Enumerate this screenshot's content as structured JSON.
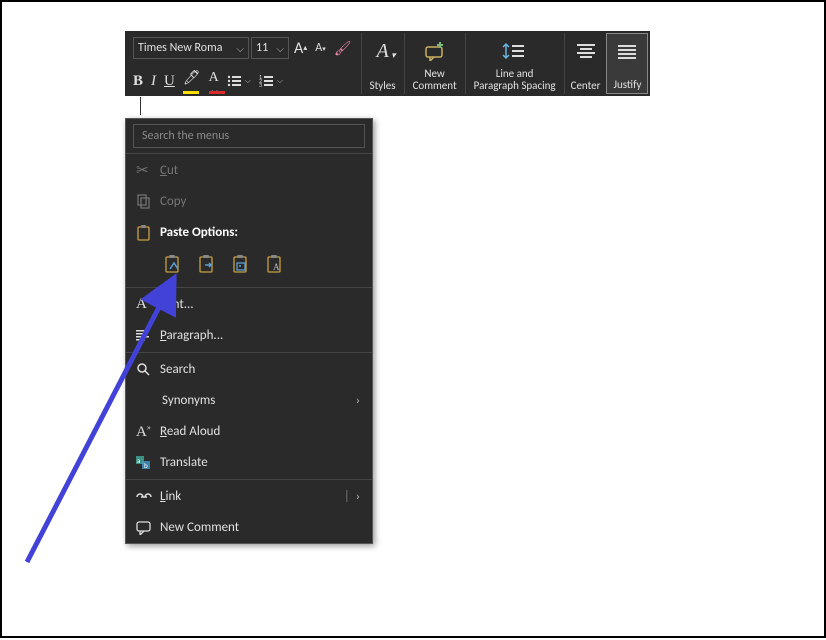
{
  "toolbar": {
    "font_name": "Times New Roma",
    "font_size": "11",
    "styles_label": "Styles",
    "new_comment_label1": "New",
    "new_comment_label2": "Comment",
    "spacing_label1": "Line and",
    "spacing_label2": "Paragraph Spacing",
    "center_label": "Center",
    "justify_label": "Justify",
    "bold": "B",
    "italic": "I",
    "underline": "U"
  },
  "context_menu": {
    "search_placeholder": "Search the menus",
    "cut": "Cut",
    "copy": "Copy",
    "paste_options": "Paste Options:",
    "font": "Font...",
    "paragraph": "Paragraph...",
    "search": "Search",
    "synonyms": "Synonyms",
    "read_aloud": "Read Aloud",
    "translate": "Translate",
    "link": "Link",
    "new_comment": "New Comment"
  },
  "icons": {
    "cut": "scissors-icon",
    "copy": "copy-icon",
    "paste": "clipboard-icon",
    "font": "font-a-icon",
    "paragraph": "paragraph-icon",
    "search": "search-icon",
    "read_aloud": "speaker-a-icon",
    "translate": "translate-icon",
    "link": "link-icon",
    "new_comment": "comment-icon"
  },
  "colors": {
    "highlight": "#ffdf00",
    "font_color": "#d92b2b",
    "accent_arrow": "#4242d9"
  }
}
